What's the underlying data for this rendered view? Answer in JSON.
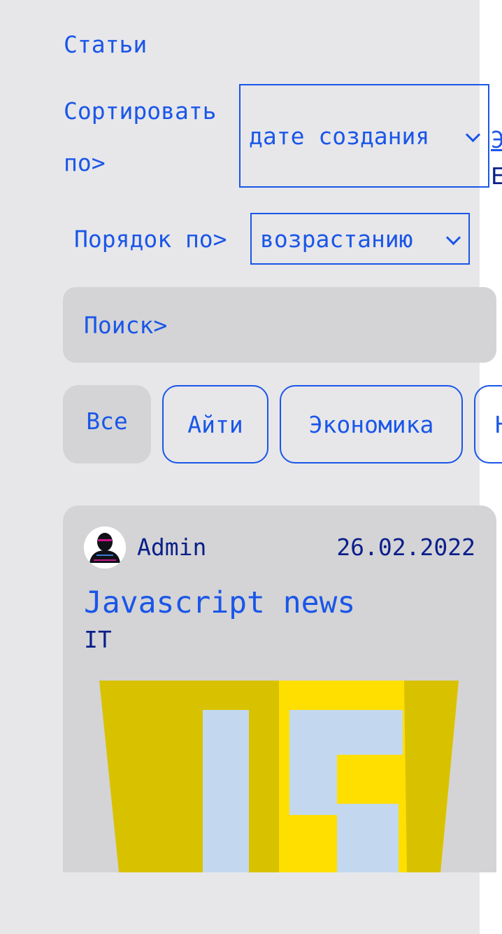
{
  "section": {
    "title": "Статьи"
  },
  "sort": {
    "label": "Сортировать по>",
    "selected": "дате создания"
  },
  "order": {
    "label": "Порядок по>",
    "selected": "возрастанию"
  },
  "overflow": {
    "line1": "Э",
    "line2": "E"
  },
  "search": {
    "label": "Поиск>"
  },
  "categories": {
    "items": [
      {
        "label": "Все"
      },
      {
        "label": "Айти"
      },
      {
        "label": "Экономика"
      },
      {
        "label": "Н"
      }
    ]
  },
  "post": {
    "author": "Admin",
    "date": "26.02.2022",
    "title": "Javascript news",
    "category": "IT"
  },
  "colors": {
    "accent": "#1a56e8",
    "text_dark": "#0a1f8a",
    "panel_bg": "#e7e7ea",
    "card_bg": "#d4d4d6",
    "js_yellow": "#d8c200",
    "js_yellow_light": "#ffdf00"
  }
}
